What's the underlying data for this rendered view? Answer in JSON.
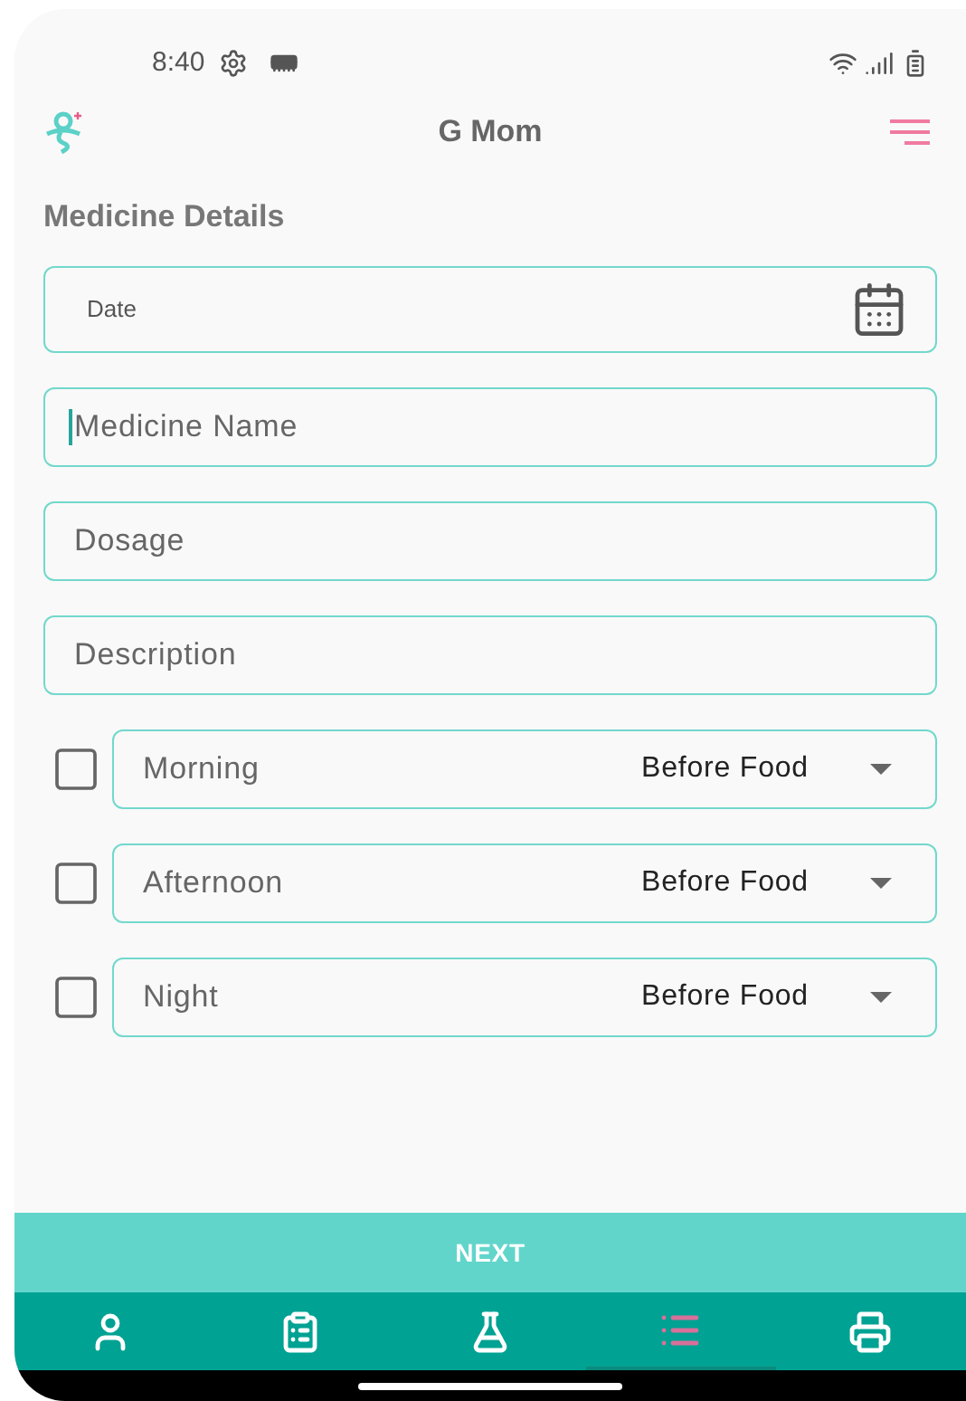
{
  "status_bar": {
    "time": "8:40"
  },
  "app_bar": {
    "title": "G Mom"
  },
  "section_title": "Medicine Details",
  "date_field": {
    "placeholder": "Date"
  },
  "fields": [
    {
      "placeholder": "Medicine Name",
      "focused": true
    },
    {
      "placeholder": "Dosage",
      "focused": false
    },
    {
      "placeholder": "Description",
      "focused": false
    }
  ],
  "schedule": [
    {
      "label": "Morning",
      "checked": false,
      "timing": "Before Food"
    },
    {
      "label": "Afternoon",
      "checked": false,
      "timing": "Before Food"
    },
    {
      "label": "Night",
      "checked": false,
      "timing": "Before Food"
    }
  ],
  "next_button": "NEXT",
  "bottom_nav": [
    {
      "kind": "person",
      "selected": false
    },
    {
      "kind": "badge",
      "selected": false
    },
    {
      "kind": "flask",
      "selected": false
    },
    {
      "kind": "list",
      "selected": true
    },
    {
      "kind": "printer",
      "selected": false
    }
  ]
}
